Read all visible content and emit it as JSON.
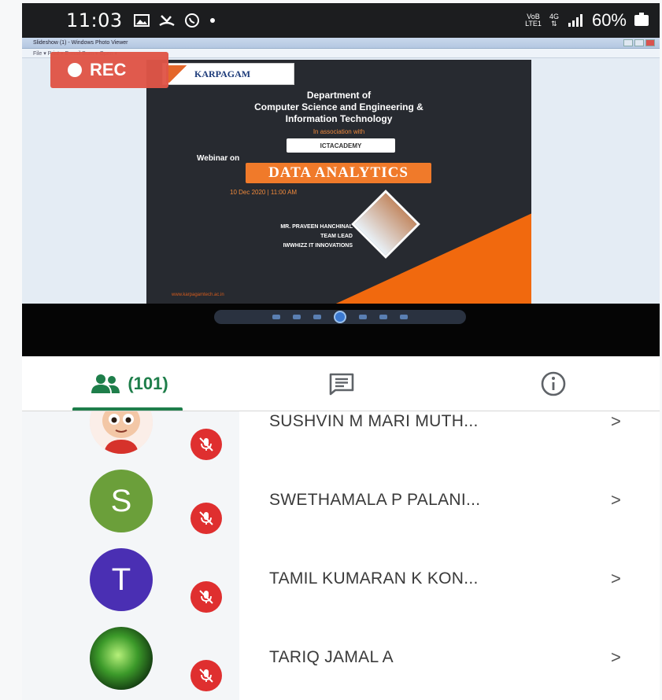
{
  "status_bar": {
    "time": "11:03",
    "network_label_top": "VoB",
    "network_label_bottom": "LTE1",
    "data_type": "4G",
    "battery": "60%"
  },
  "presentation": {
    "window_title": "Slideshow (1) - Windows Photo Viewer",
    "menu_text": "File ▾   Print ▾   E-mail   Burn ▾   Open ▾",
    "rec_label": "REC",
    "poster": {
      "logo_text": "KARPAGAM",
      "department_line1": "Department of",
      "department_line2": "Computer Science and Engineering &",
      "department_line3": "Information Technology",
      "association": "In association with",
      "partner": "ICTACADEMY",
      "webinar_on": "Webinar on",
      "topic": "DATA ANALYTICS",
      "date_time": "10 Dec 2020 | 11:00 AM",
      "speaker_name": "MR. PRAVEEN HANCHINAL",
      "speaker_role": "TEAM LEAD",
      "speaker_org": "IWWHIZZ IT INNOVATIONS",
      "footer_url": "www.karpagamtech.ac.in"
    }
  },
  "tabs": {
    "people_count": "(101)",
    "icons": [
      "people-icon",
      "chat-icon",
      "info-icon"
    ]
  },
  "participants": [
    {
      "name": "SUSHVIN M MARI MUTH...",
      "avatar_type": "cartoon",
      "initial": ""
    },
    {
      "name": "SWETHAMALA P PALANI...",
      "avatar_type": "letter",
      "initial": "S",
      "color": "#6b9f3a"
    },
    {
      "name": "TAMIL KUMARAN K KON...",
      "avatar_type": "letter",
      "initial": "T",
      "color": "#4a2fb3"
    },
    {
      "name": "TARIQ JAMAL A",
      "avatar_type": "photo",
      "initial": ""
    }
  ],
  "colors": {
    "accent_green": "#1e7e4a",
    "mute_red": "#df2f2f",
    "rec_red": "#e05547"
  }
}
